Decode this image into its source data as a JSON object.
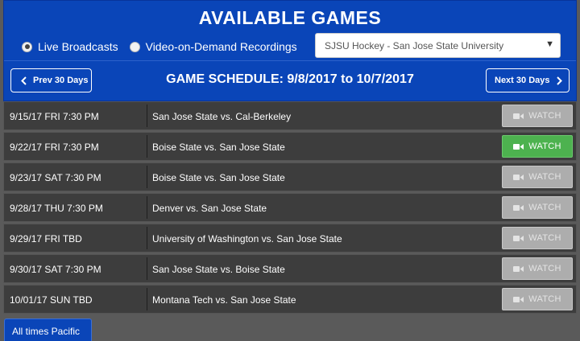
{
  "header": {
    "title": "AVAILABLE GAMES",
    "radio_options": [
      {
        "label": "Live Broadcasts",
        "selected": true
      },
      {
        "label": "Video-on-Demand Recordings",
        "selected": false
      }
    ],
    "team_select": {
      "value": "SJSU Hockey - San Jose State University"
    },
    "prev_label": "Prev 30 Days",
    "next_label": "Next 30 Days",
    "schedule_title": "GAME SCHEDULE: 9/8/2017 to 10/7/2017",
    "accent_color": "#0a45b8"
  },
  "games": [
    {
      "datetime": "9/15/17 FRI 7:30 PM",
      "matchup": "San Jose State vs. Cal-Berkeley",
      "watch_label": "WATCH",
      "watch_enabled": false
    },
    {
      "datetime": "9/22/17 FRI 7:30 PM",
      "matchup": "Boise State vs. San Jose State",
      "watch_label": "WATCH",
      "watch_enabled": true
    },
    {
      "datetime": "9/23/17 SAT 7:30 PM",
      "matchup": "Boise State vs. San Jose State",
      "watch_label": "WATCH",
      "watch_enabled": false
    },
    {
      "datetime": "9/28/17 THU 7:30 PM",
      "matchup": "Denver vs. San Jose State",
      "watch_label": "WATCH",
      "watch_enabled": false
    },
    {
      "datetime": "9/29/17 FRI TBD",
      "matchup": "University of Washington vs. San Jose State",
      "watch_label": "WATCH",
      "watch_enabled": false
    },
    {
      "datetime": "9/30/17 SAT 7:30 PM",
      "matchup": "San Jose State vs. Boise State",
      "watch_label": "WATCH",
      "watch_enabled": false
    },
    {
      "datetime": "10/01/17 SUN TBD",
      "matchup": "Montana Tech vs. San Jose State",
      "watch_label": "WATCH",
      "watch_enabled": false
    }
  ],
  "footer": {
    "timezone_note": "All times Pacific"
  },
  "icons": {
    "watch": "video-camera-icon",
    "prev": "chevron-left-icon",
    "next": "chevron-right-icon",
    "select": "caret-down-icon"
  }
}
